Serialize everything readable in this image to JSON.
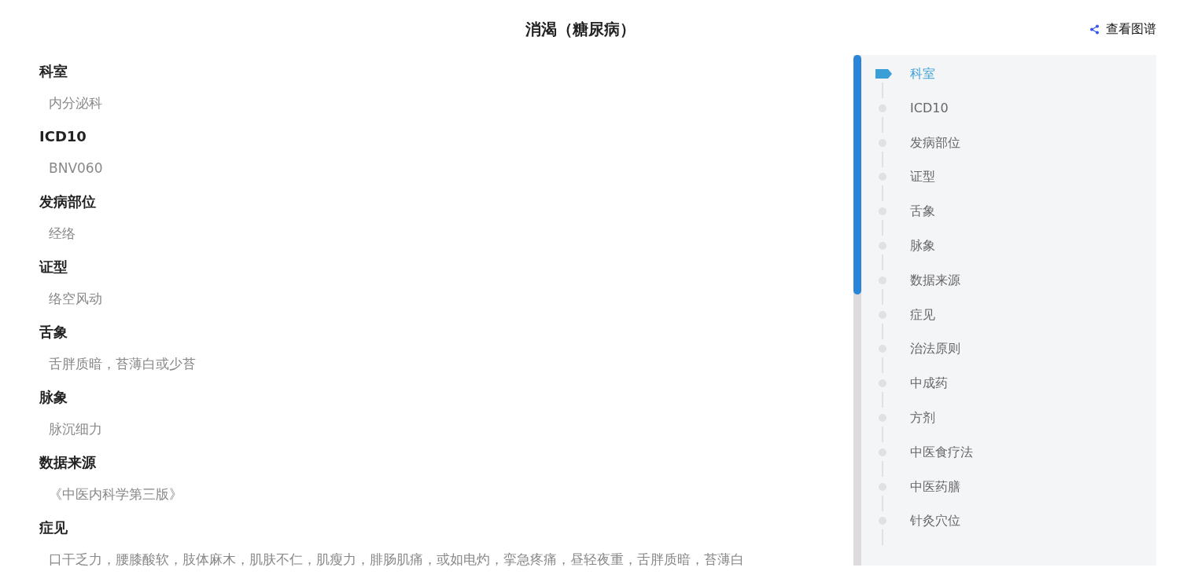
{
  "title": "消渴（糖尿病）",
  "graph_link": "查看图谱",
  "sections": [
    {
      "heading": "科室",
      "value": "内分泌科"
    },
    {
      "heading": "ICD10",
      "value": "BNV060"
    },
    {
      "heading": "发病部位",
      "value": "经络"
    },
    {
      "heading": "证型",
      "value": "络空风动"
    },
    {
      "heading": "舌象",
      "value": "舌胖质暗，苔薄白或少苔"
    },
    {
      "heading": "脉象",
      "value": "脉沉细力"
    },
    {
      "heading": "数据来源",
      "value": "《中医内科学第三版》"
    },
    {
      "heading": "症见",
      "value": "口干乏力，腰膝酸软，肢体麻木，肌肤不仁，肌瘦力，腓肠肌痛，或如电灼，挛急疼痛，昼轻夜重，舌胖质暗，苔薄白"
    }
  ],
  "toc": [
    {
      "label": "科室",
      "selected": true
    },
    {
      "label": "ICD10",
      "selected": false
    },
    {
      "label": "发病部位",
      "selected": false
    },
    {
      "label": "证型",
      "selected": false
    },
    {
      "label": "舌象",
      "selected": false
    },
    {
      "label": "脉象",
      "selected": false
    },
    {
      "label": "数据来源",
      "selected": false
    },
    {
      "label": "症见",
      "selected": false
    },
    {
      "label": "治法原则",
      "selected": false
    },
    {
      "label": "中成药",
      "selected": false
    },
    {
      "label": "方剂",
      "selected": false
    },
    {
      "label": "中医食疗法",
      "selected": false
    },
    {
      "label": "中医药膳",
      "selected": false
    },
    {
      "label": "针灸穴位",
      "selected": false
    }
  ]
}
